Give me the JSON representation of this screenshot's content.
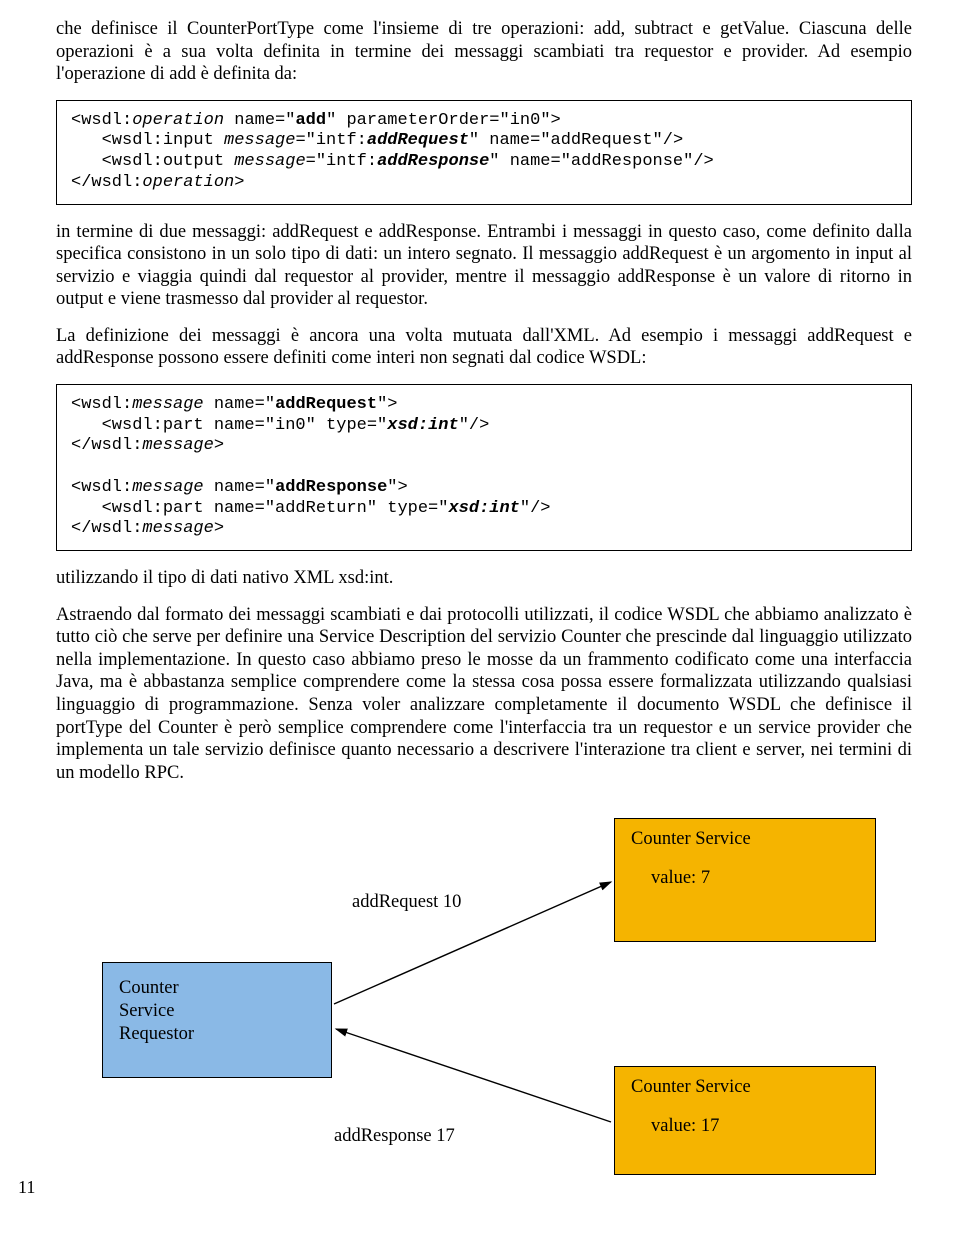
{
  "paragraphs": {
    "p1": "che definisce il CounterPortType come l'insieme di tre operazioni: add, subtract e getValue. Ciascuna delle operazioni è a sua volta definita in termine dei messaggi scambiati tra requestor e provider. Ad esempio l'operazione di add è definita da:",
    "p2a": "in termine di due messaggi: addRequest e addResponse. Entrambi i messaggi in questo caso, come definito dalla specifica consistono in un solo tipo di dati: un intero segnato. Il messaggio addRequest è un argomento in input al servizio e viaggia quindi dal requestor al provider, mentre il messaggio addResponse è un valore di ritorno in output e viene trasmesso dal provider al requestor.",
    "p2b": "La definizione dei messaggi è ancora una volta mutuata dall'XML. Ad esempio i messaggi addRequest e addResponse possono essere definiti come interi non segnati dal codice WSDL:",
    "p3": "utilizzando il tipo di dati nativo XML xsd:int.",
    "p4": "Astraendo dal formato dei messaggi scambiati e dai protocolli utilizzati, il codice WSDL che abbiamo analizzato è tutto ciò che serve per definire una Service Description del servizio Counter che prescinde dal linguaggio utilizzato nella implementazione. In questo caso abbiamo preso le mosse da un frammento codificato come una interfaccia Java, ma è abbastanza semplice comprendere come la stessa cosa possa essere formalizzata utilizzando qualsiasi linguaggio di programmazione. Senza voler analizzare completamente il documento WSDL che definisce il portType del Counter è però semplice comprendere come l'interfaccia tra un requestor e un service provider che implementa un tale servizio definisce quanto necessario a descrivere l'interazione tra client e server, nei termini di un modello RPC."
  },
  "code1": {
    "l1a": "<wsdl:",
    "l1b": "operation",
    "l1c": " name=\"",
    "l1d": "add",
    "l1e": "\" parameterOrder=\"in0\">",
    "l2a": "   <wsdl:input ",
    "l2b": "message",
    "l2c": "=\"intf:",
    "l2d": "addRequest",
    "l2e": "\" name=\"addRequest\"/>",
    "l3a": "   <wsdl:output ",
    "l3b": "message",
    "l3c": "=\"intf:",
    "l3d": "addResponse",
    "l3e": "\" name=\"addResponse\"/>",
    "l4a": "</wsdl:",
    "l4b": "operation",
    "l4c": ">"
  },
  "code2": {
    "l1a": "<wsdl:",
    "l1b": "message",
    "l1c": " name=\"",
    "l1d": "addRequest",
    "l1e": "\">",
    "l2a": "   <wsdl:part name=\"in0\" type=\"",
    "l2b": "xsd:int",
    "l2c": "\"/>",
    "l3a": "</wsdl:",
    "l3b": "message",
    "l3c": ">",
    "gap": " ",
    "l4a": "<wsdl:",
    "l4b": "message",
    "l4c": " name=\"",
    "l4d": "addResponse",
    "l4e": "\">",
    "l5a": "   <wsdl:part name=\"addReturn\" type=\"",
    "l5b": "xsd:int",
    "l5c": "\"/>",
    "l6a": "</wsdl:",
    "l6b": "message",
    "l6c": ">"
  },
  "diagram": {
    "requestor": "Counter\nService\nRequestor",
    "service_top_title": "Counter Service",
    "service_top_value": "value: 7",
    "service_bottom_title": "Counter Service",
    "service_bottom_value": "value: 17",
    "msg_top": "addRequest 10",
    "msg_bottom": "addResponse 17"
  },
  "pageNumber": "11"
}
